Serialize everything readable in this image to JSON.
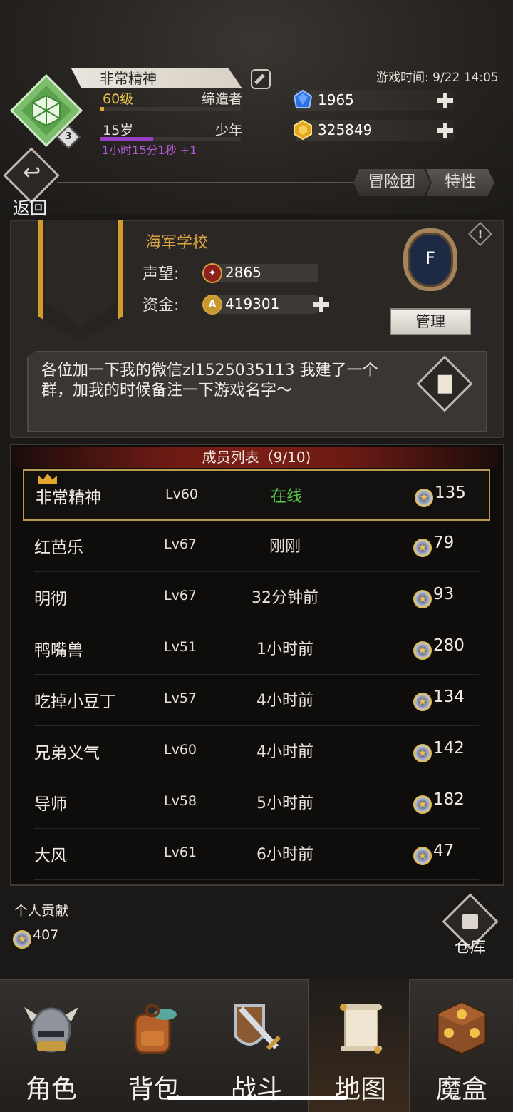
{
  "player": {
    "name": "非常精神",
    "level": "60级",
    "title": "缔造者",
    "level_progress": 0.03,
    "age": "15岁",
    "age_stage": "少年",
    "age_progress": 0.38,
    "timer": "1小时15分1秒 +1",
    "badge": "3"
  },
  "game_time": "游戏时间: 9/22 14:05",
  "currency": {
    "diamond": "1965",
    "gold": "325849"
  },
  "nav_top": {
    "back_label": "返回",
    "tabs": [
      "冒险团",
      "特性"
    ]
  },
  "guild": {
    "name": "海军学校",
    "reputation_label": "声望:",
    "reputation": "2865",
    "funds_label": "资金:",
    "funds": "419301",
    "emblem_letter": "F",
    "manage_label": "管理",
    "notice": "各位加一下我的微信zl1525035113 我建了一个群，加我的时候备注一下游戏名字～"
  },
  "members": {
    "header": "成员列表（9/10)",
    "rows": [
      {
        "name": "非常精神",
        "level": "Lv60",
        "status": "在线",
        "contribution": "135"
      },
      {
        "name": "红芭乐",
        "level": "Lv67",
        "status": "刚刚",
        "contribution": "79"
      },
      {
        "name": "明彻",
        "level": "Lv67",
        "status": "32分钟前",
        "contribution": "93"
      },
      {
        "name": "鸭嘴兽",
        "level": "Lv51",
        "status": "1小时前",
        "contribution": "280"
      },
      {
        "name": "吃掉小豆丁",
        "level": "Lv57",
        "status": "4小时前",
        "contribution": "134"
      },
      {
        "name": "兄弟义气",
        "level": "Lv60",
        "status": "4小时前",
        "contribution": "142"
      },
      {
        "name": "导师",
        "level": "Lv58",
        "status": "5小时前",
        "contribution": "182"
      },
      {
        "name": "大风",
        "level": "Lv61",
        "status": "6小时前",
        "contribution": "47"
      }
    ]
  },
  "personal": {
    "label": "个人贡献",
    "value": "407"
  },
  "warehouse_label": "仓库",
  "bottom_nav": [
    "角色",
    "背包",
    "战斗",
    "地图",
    "魔盒"
  ],
  "colors": {
    "accent_gold": "#d39b2c",
    "online_green": "#55c94a",
    "timer_purple": "#b25ad8"
  }
}
